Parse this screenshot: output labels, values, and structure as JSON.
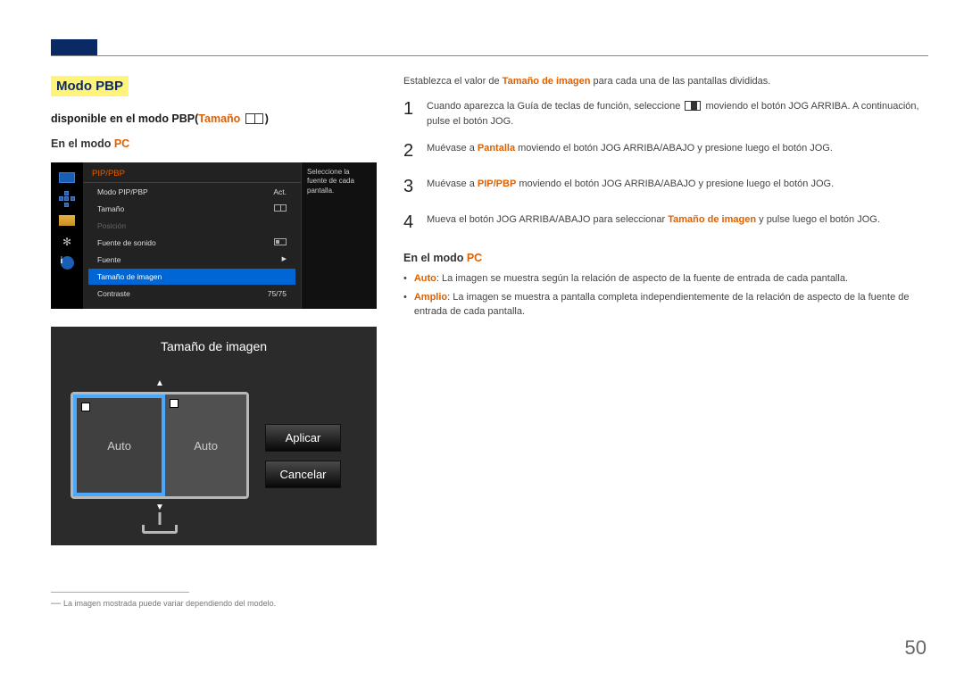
{
  "section_title": "Modo PBP",
  "subtitle_prefix": "disponible en el modo PBP(",
  "subtitle_size": "Tamaño",
  "subtitle_suffix": ")",
  "mode_label_prefix": "En el modo ",
  "mode_label_pc": "PC",
  "osd1": {
    "header": "PIP/PBP",
    "tip": "Seleccione la fuente de cada pantalla.",
    "rows": [
      {
        "label": "Modo PIP/PBP",
        "value": "Act."
      },
      {
        "label": "Tamaño",
        "icon": "pbp"
      },
      {
        "label": "Posición",
        "dim": true
      },
      {
        "label": "Fuente de sonido",
        "icon": "sound"
      },
      {
        "label": "Fuente",
        "arrow": true
      },
      {
        "label": "Tamaño de imagen",
        "hl": true
      },
      {
        "label": "Contraste",
        "value": "75/75"
      }
    ]
  },
  "osd2": {
    "title": "Tamaño de imagen",
    "pane1": "Auto",
    "pane2": "Auto",
    "btn_apply": "Aplicar",
    "btn_cancel": "Cancelar"
  },
  "footnote": "La imagen mostrada puede variar dependiendo del modelo.",
  "right": {
    "intro_pre": "Establezca el valor de ",
    "intro_bold": "Tamaño de imagen",
    "intro_post": " para cada una de las pantallas divididas.",
    "steps": [
      {
        "n": "1",
        "pre": "Cuando aparezca la Guía de teclas de función, seleccione ",
        "post": " moviendo el botón JOG ARRIBA. A continuación, pulse el botón JOG."
      },
      {
        "n": "2",
        "pre": "Muévase a ",
        "bold": "Pantalla",
        "post": " moviendo el botón JOG ARRIBA/ABAJO y presione luego el botón JOG."
      },
      {
        "n": "3",
        "pre": "Muévase a ",
        "bold": "PIP/PBP",
        "post": " moviendo el botón JOG ARRIBA/ABAJO y presione luego el botón JOG."
      },
      {
        "n": "4",
        "pre": "Mueva el botón JOG ARRIBA/ABAJO para seleccionar ",
        "bold": "Tamaño de imagen",
        "post": " y pulse luego el botón JOG."
      }
    ],
    "mode2_prefix": "En el modo ",
    "mode2_pc": "PC",
    "bullets": [
      {
        "bold": "Auto",
        "text": ": La imagen se muestra según la relación de aspecto de la fuente de entrada de cada pantalla."
      },
      {
        "bold": "Amplio",
        "text": ": La imagen se muestra a pantalla completa independientemente de la relación de aspecto de la fuente de entrada de cada pantalla."
      }
    ]
  },
  "page_num": "50"
}
